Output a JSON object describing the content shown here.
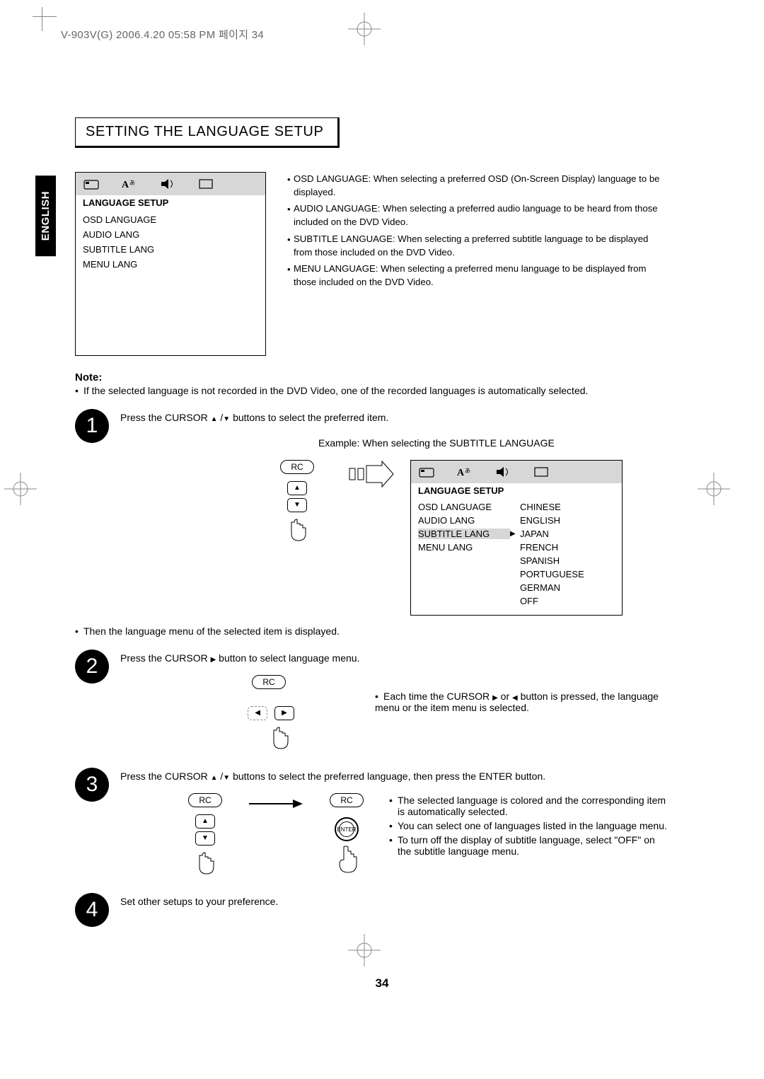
{
  "header": "V-903V(G)  2006.4.20  05:58 PM   페이지 34",
  "sidebar_tab": "ENGLISH",
  "section_title": "SETTING THE LANGUAGE SETUP",
  "menu1": {
    "heading": "LANGUAGE SETUP",
    "items": [
      "OSD LANGUAGE",
      "AUDIO LANG",
      "SUBTITLE LANG",
      "MENU LANG"
    ]
  },
  "definitions": [
    {
      "label": "OSD LANGUAGE:",
      "text": " When selecting a preferred OSD (On-Screen Display) language to be displayed."
    },
    {
      "label": "AUDIO LANGUAGE:",
      "text": " When selecting a preferred audio language to be heard from those included on the DVD Video."
    },
    {
      "label": "SUBTITLE LANGUAGE:",
      "text": " When selecting a preferred subtitle language to be displayed from those included on the DVD Video."
    },
    {
      "label": "MENU LANGUAGE:",
      "text": " When selecting a preferred menu language to be displayed from those included on the DVD Video."
    }
  ],
  "note": {
    "heading": "Note:",
    "body": "If the selected language is not recorded in the DVD Video, one of the recorded languages is automatically selected."
  },
  "step1": {
    "num": "1",
    "text_a": "Press the CURSOR ",
    "text_b": "  buttons to select the preferred item.",
    "example": "Example: When selecting the SUBTITLE LANGUAGE"
  },
  "rc_label": "RC",
  "menu2": {
    "heading": "LANGUAGE SETUP",
    "rows": [
      {
        "c1": "OSD LANGUAGE",
        "c3": "CHINESE"
      },
      {
        "c1": "AUDIO LANG",
        "c3": "ENGLISH"
      },
      {
        "c1": "SUBTITLE LANG",
        "c3": "JAPAN",
        "hl": true,
        "ptr": true
      },
      {
        "c1": "MENU LANG",
        "c3": "FRENCH"
      }
    ],
    "extra": [
      "SPANISH",
      "PORTUGUESE",
      "GERMAN",
      "OFF"
    ]
  },
  "post1": "Then the language menu of the selected item is displayed.",
  "step2": {
    "num": "2",
    "text_a": "Press the CURSOR ",
    "text_b": "  button to select language menu.",
    "side_a": "Each time the CURSOR ",
    "side_b": "  or ",
    "side_c": "  button is pressed, the language menu or the item menu is selected."
  },
  "step3": {
    "num": "3",
    "text_a": "Press the CURSOR ",
    "text_b": "  buttons to select the preferred language, then press the ENTER button.",
    "bullets": [
      "The selected language is colored and the corresponding item is automatically selected.",
      "You can select one of languages listed in the language menu.",
      "To turn off the display of subtitle language, select \"OFF\" on the subtitle language menu."
    ]
  },
  "enter_label": "ENTER",
  "step4": {
    "num": "4",
    "text": "Set other setups to your preference."
  },
  "page_number": "34"
}
